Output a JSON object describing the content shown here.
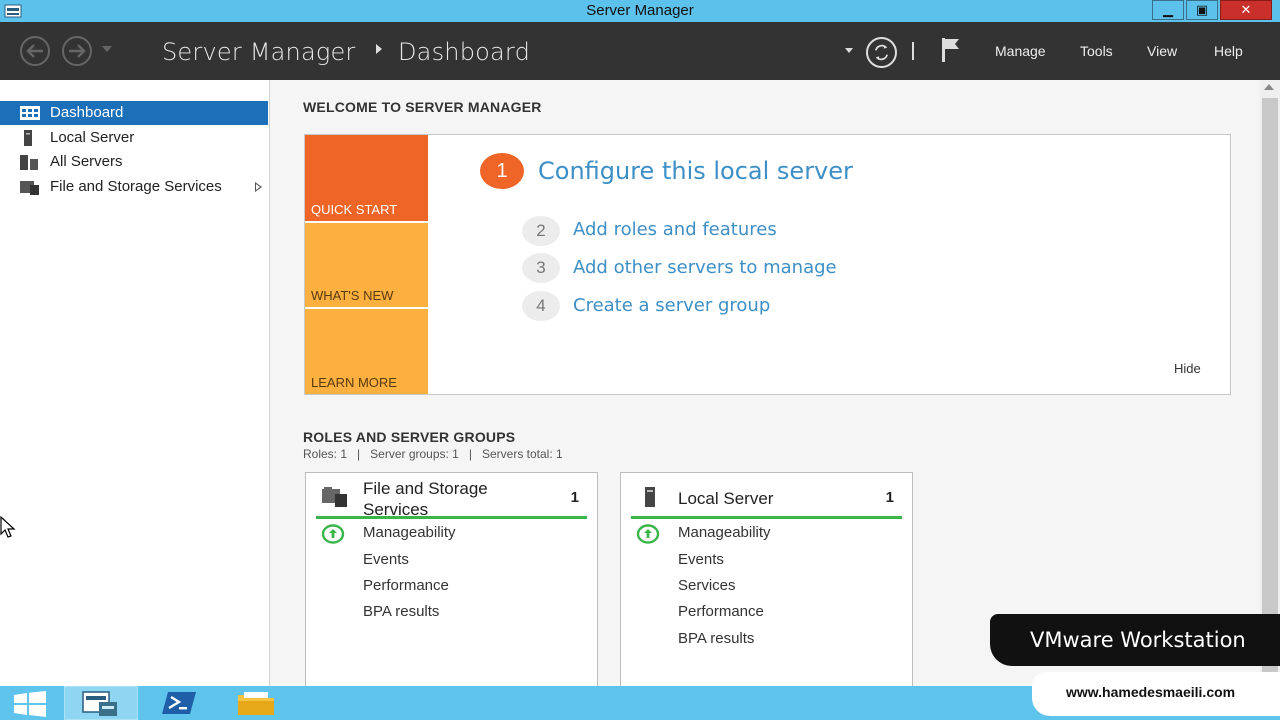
{
  "window": {
    "title": "Server Manager",
    "controls": {
      "minimize": "▁",
      "maximize": "▣",
      "close": "✕"
    }
  },
  "header": {
    "breadcrumb": [
      "Server Manager",
      "Dashboard"
    ],
    "menu": [
      "Manage",
      "Tools",
      "View",
      "Help"
    ]
  },
  "sidebar": {
    "items": [
      {
        "label": "Dashboard",
        "icon": "dashboard-icon",
        "active": true
      },
      {
        "label": "Local Server",
        "icon": "server-icon"
      },
      {
        "label": "All Servers",
        "icon": "servers-icon"
      },
      {
        "label": "File and Storage Services",
        "icon": "storage-icon",
        "has_submenu": true
      }
    ]
  },
  "welcome": {
    "heading": "WELCOME TO SERVER MANAGER",
    "tiles": [
      "QUICK START",
      "WHAT'S NEW",
      "LEARN MORE"
    ],
    "steps": [
      {
        "num": "1",
        "label": "Configure this local server"
      },
      {
        "num": "2",
        "label": "Add roles and features"
      },
      {
        "num": "3",
        "label": "Add other servers to manage"
      },
      {
        "num": "4",
        "label": "Create a server group"
      }
    ],
    "hide_label": "Hide"
  },
  "roles": {
    "heading": "ROLES AND SERVER GROUPS",
    "stats": "Roles: 1   |   Server groups: 1   |   Servers total: 1",
    "cards": [
      {
        "title": "File and Storage Services",
        "count": "1",
        "rows": [
          "Manageability",
          "Events",
          "Performance",
          "BPA results"
        ]
      },
      {
        "title": "Local Server",
        "count": "1",
        "rows": [
          "Manageability",
          "Events",
          "Services",
          "Performance",
          "BPA results"
        ]
      }
    ]
  },
  "overlay": {
    "vmware": "VMware Workstation",
    "website": "www.hamedesmaeili.com"
  },
  "colors": {
    "accent": "#1c6fb9",
    "quick_start": "#ef6427",
    "tile": "#fbb040",
    "link": "#3d8fc6",
    "ok": "#39b54a"
  }
}
